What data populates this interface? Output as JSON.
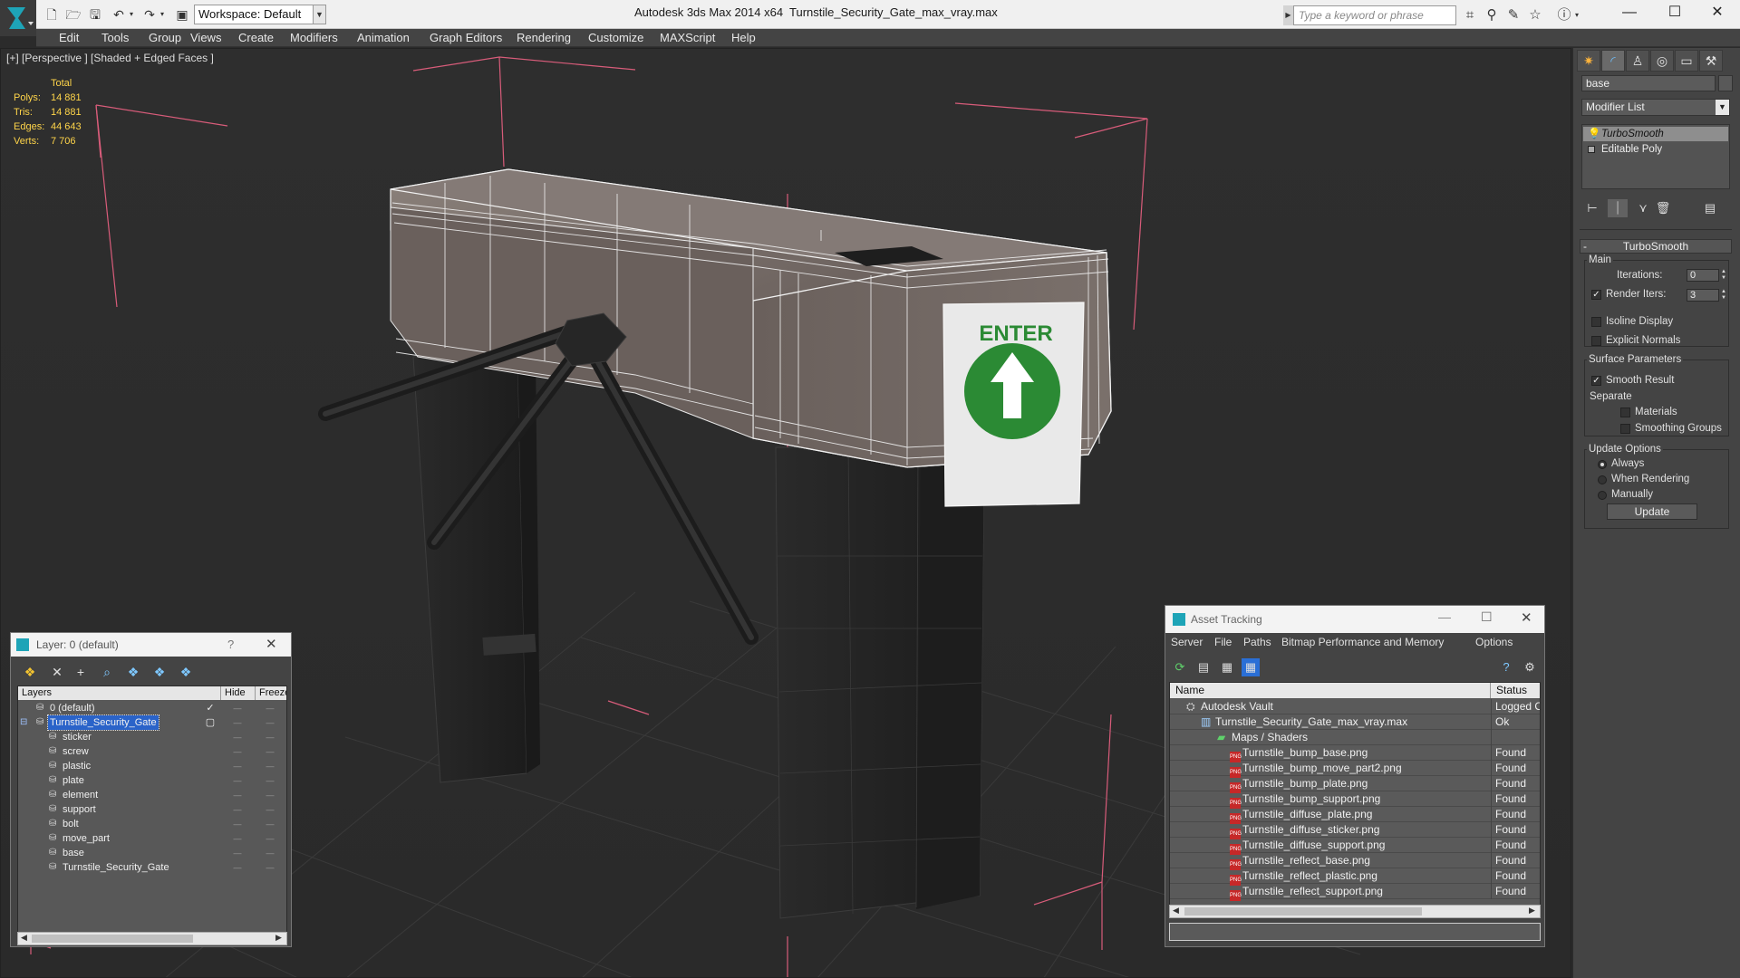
{
  "titlebar": {
    "workspace": "Workspace: Default",
    "app_name": "Autodesk 3ds Max  2014 x64",
    "file_name": "Turnstile_Security_Gate_max_vray.max",
    "search_placeholder": "Type a keyword or phrase"
  },
  "menubar": [
    "Edit",
    "Tools",
    "Group",
    "Views",
    "Create",
    "Modifiers",
    "Animation",
    "Graph Editors",
    "Rendering",
    "Customize",
    "MAXScript",
    "Help"
  ],
  "viewport": {
    "label": "[+] [Perspective ] [Shaded + Edged Faces ]",
    "stats_header": "Total",
    "stats": [
      {
        "label": "Polys:",
        "value": "14 881"
      },
      {
        "label": "Tris:",
        "value": "14 881"
      },
      {
        "label": "Edges:",
        "value": "44 643"
      },
      {
        "label": "Verts:",
        "value": "7 706"
      }
    ],
    "sign_text": "ENTER"
  },
  "command_panel": {
    "object_name": "base",
    "modifier_list": "Modifier List",
    "stack": [
      "TurboSmooth",
      "Editable Poly"
    ],
    "rollout_title": "TurboSmooth",
    "main_group": "Main",
    "iterations_label": "Iterations:",
    "iterations_value": "0",
    "render_iters_label": "Render Iters:",
    "render_iters_value": "3",
    "isoline_label": "Isoline Display",
    "explicit_normals_label": "Explicit Normals",
    "surface_group": "Surface Parameters",
    "smooth_result_label": "Smooth Result",
    "separate_label": "Separate",
    "materials_label": "Materials",
    "smoothing_groups_label": "Smoothing Groups",
    "update_group": "Update Options",
    "always_label": "Always",
    "when_rendering_label": "When Rendering",
    "manually_label": "Manually",
    "update_button": "Update"
  },
  "layer_dialog": {
    "title": "Layer: 0 (default)",
    "help": "?",
    "columns": [
      "Layers",
      "Hide",
      "Freeze"
    ],
    "layers": [
      {
        "name": "0 (default)",
        "indent": 1,
        "checked": true
      },
      {
        "name": "Turnstile_Security_Gate",
        "indent": 1,
        "selected": true
      },
      {
        "name": "sticker",
        "indent": 2
      },
      {
        "name": "screw",
        "indent": 2
      },
      {
        "name": "plastic",
        "indent": 2
      },
      {
        "name": "plate",
        "indent": 2
      },
      {
        "name": "element",
        "indent": 2
      },
      {
        "name": "support",
        "indent": 2
      },
      {
        "name": "bolt",
        "indent": 2
      },
      {
        "name": "move_part",
        "indent": 2
      },
      {
        "name": "base",
        "indent": 2
      },
      {
        "name": "Turnstile_Security_Gate",
        "indent": 2
      }
    ]
  },
  "asset_tracking": {
    "title": "Asset Tracking",
    "menu": [
      "Server",
      "File",
      "Paths",
      "Bitmap Performance and Memory",
      "Options"
    ],
    "columns": [
      "Name",
      "Status"
    ],
    "rows": [
      {
        "name": "Autodesk Vault",
        "status": "Logged O",
        "level": 0,
        "icon": "vault"
      },
      {
        "name": "Turnstile_Security_Gate_max_vray.max",
        "status": "Ok",
        "level": 1,
        "icon": "max"
      },
      {
        "name": "Maps / Shaders",
        "status": "",
        "level": 2,
        "icon": "maps"
      },
      {
        "name": "Turnstile_bump_base.png",
        "status": "Found",
        "level": 3,
        "icon": "png"
      },
      {
        "name": "Turnstile_bump_move_part2.png",
        "status": "Found",
        "level": 3,
        "icon": "png"
      },
      {
        "name": "Turnstile_bump_plate.png",
        "status": "Found",
        "level": 3,
        "icon": "png"
      },
      {
        "name": "Turnstile_bump_support.png",
        "status": "Found",
        "level": 3,
        "icon": "png"
      },
      {
        "name": "Turnstile_diffuse_plate.png",
        "status": "Found",
        "level": 3,
        "icon": "png"
      },
      {
        "name": "Turnstile_diffuse_sticker.png",
        "status": "Found",
        "level": 3,
        "icon": "png"
      },
      {
        "name": "Turnstile_diffuse_support.png",
        "status": "Found",
        "level": 3,
        "icon": "png"
      },
      {
        "name": "Turnstile_reflect_base.png",
        "status": "Found",
        "level": 3,
        "icon": "png"
      },
      {
        "name": "Turnstile_reflect_plastic.png",
        "status": "Found",
        "level": 3,
        "icon": "png"
      },
      {
        "name": "Turnstile_reflect_support.png",
        "status": "Found",
        "level": 3,
        "icon": "png"
      }
    ]
  }
}
